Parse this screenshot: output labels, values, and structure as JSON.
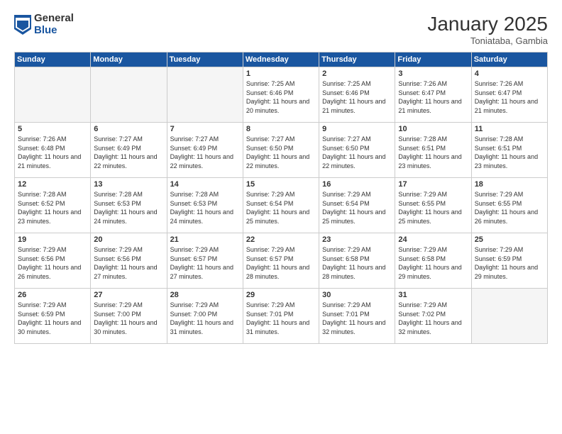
{
  "logo": {
    "general": "General",
    "blue": "Blue"
  },
  "header": {
    "month": "January 2025",
    "location": "Toniataba, Gambia"
  },
  "weekdays": [
    "Sunday",
    "Monday",
    "Tuesday",
    "Wednesday",
    "Thursday",
    "Friday",
    "Saturday"
  ],
  "weeks": [
    [
      {
        "day": "",
        "empty": true
      },
      {
        "day": "",
        "empty": true
      },
      {
        "day": "",
        "empty": true
      },
      {
        "day": "1",
        "sunrise": "7:25 AM",
        "sunset": "6:46 PM",
        "daylight": "11 hours and 20 minutes."
      },
      {
        "day": "2",
        "sunrise": "7:25 AM",
        "sunset": "6:46 PM",
        "daylight": "11 hours and 21 minutes."
      },
      {
        "day": "3",
        "sunrise": "7:26 AM",
        "sunset": "6:47 PM",
        "daylight": "11 hours and 21 minutes."
      },
      {
        "day": "4",
        "sunrise": "7:26 AM",
        "sunset": "6:47 PM",
        "daylight": "11 hours and 21 minutes."
      }
    ],
    [
      {
        "day": "5",
        "sunrise": "7:26 AM",
        "sunset": "6:48 PM",
        "daylight": "11 hours and 21 minutes."
      },
      {
        "day": "6",
        "sunrise": "7:27 AM",
        "sunset": "6:49 PM",
        "daylight": "11 hours and 22 minutes."
      },
      {
        "day": "7",
        "sunrise": "7:27 AM",
        "sunset": "6:49 PM",
        "daylight": "11 hours and 22 minutes."
      },
      {
        "day": "8",
        "sunrise": "7:27 AM",
        "sunset": "6:50 PM",
        "daylight": "11 hours and 22 minutes."
      },
      {
        "day": "9",
        "sunrise": "7:27 AM",
        "sunset": "6:50 PM",
        "daylight": "11 hours and 22 minutes."
      },
      {
        "day": "10",
        "sunrise": "7:28 AM",
        "sunset": "6:51 PM",
        "daylight": "11 hours and 23 minutes."
      },
      {
        "day": "11",
        "sunrise": "7:28 AM",
        "sunset": "6:51 PM",
        "daylight": "11 hours and 23 minutes."
      }
    ],
    [
      {
        "day": "12",
        "sunrise": "7:28 AM",
        "sunset": "6:52 PM",
        "daylight": "11 hours and 23 minutes."
      },
      {
        "day": "13",
        "sunrise": "7:28 AM",
        "sunset": "6:53 PM",
        "daylight": "11 hours and 24 minutes."
      },
      {
        "day": "14",
        "sunrise": "7:28 AM",
        "sunset": "6:53 PM",
        "daylight": "11 hours and 24 minutes."
      },
      {
        "day": "15",
        "sunrise": "7:29 AM",
        "sunset": "6:54 PM",
        "daylight": "11 hours and 25 minutes."
      },
      {
        "day": "16",
        "sunrise": "7:29 AM",
        "sunset": "6:54 PM",
        "daylight": "11 hours and 25 minutes."
      },
      {
        "day": "17",
        "sunrise": "7:29 AM",
        "sunset": "6:55 PM",
        "daylight": "11 hours and 25 minutes."
      },
      {
        "day": "18",
        "sunrise": "7:29 AM",
        "sunset": "6:55 PM",
        "daylight": "11 hours and 26 minutes."
      }
    ],
    [
      {
        "day": "19",
        "sunrise": "7:29 AM",
        "sunset": "6:56 PM",
        "daylight": "11 hours and 26 minutes."
      },
      {
        "day": "20",
        "sunrise": "7:29 AM",
        "sunset": "6:56 PM",
        "daylight": "11 hours and 27 minutes."
      },
      {
        "day": "21",
        "sunrise": "7:29 AM",
        "sunset": "6:57 PM",
        "daylight": "11 hours and 27 minutes."
      },
      {
        "day": "22",
        "sunrise": "7:29 AM",
        "sunset": "6:57 PM",
        "daylight": "11 hours and 28 minutes."
      },
      {
        "day": "23",
        "sunrise": "7:29 AM",
        "sunset": "6:58 PM",
        "daylight": "11 hours and 28 minutes."
      },
      {
        "day": "24",
        "sunrise": "7:29 AM",
        "sunset": "6:58 PM",
        "daylight": "11 hours and 29 minutes."
      },
      {
        "day": "25",
        "sunrise": "7:29 AM",
        "sunset": "6:59 PM",
        "daylight": "11 hours and 29 minutes."
      }
    ],
    [
      {
        "day": "26",
        "sunrise": "7:29 AM",
        "sunset": "6:59 PM",
        "daylight": "11 hours and 30 minutes."
      },
      {
        "day": "27",
        "sunrise": "7:29 AM",
        "sunset": "7:00 PM",
        "daylight": "11 hours and 30 minutes."
      },
      {
        "day": "28",
        "sunrise": "7:29 AM",
        "sunset": "7:00 PM",
        "daylight": "11 hours and 31 minutes."
      },
      {
        "day": "29",
        "sunrise": "7:29 AM",
        "sunset": "7:01 PM",
        "daylight": "11 hours and 31 minutes."
      },
      {
        "day": "30",
        "sunrise": "7:29 AM",
        "sunset": "7:01 PM",
        "daylight": "11 hours and 32 minutes."
      },
      {
        "day": "31",
        "sunrise": "7:29 AM",
        "sunset": "7:02 PM",
        "daylight": "11 hours and 32 minutes."
      },
      {
        "day": "",
        "empty": true
      }
    ]
  ],
  "labels": {
    "sunrise": "Sunrise:",
    "sunset": "Sunset:",
    "daylight": "Daylight:"
  }
}
